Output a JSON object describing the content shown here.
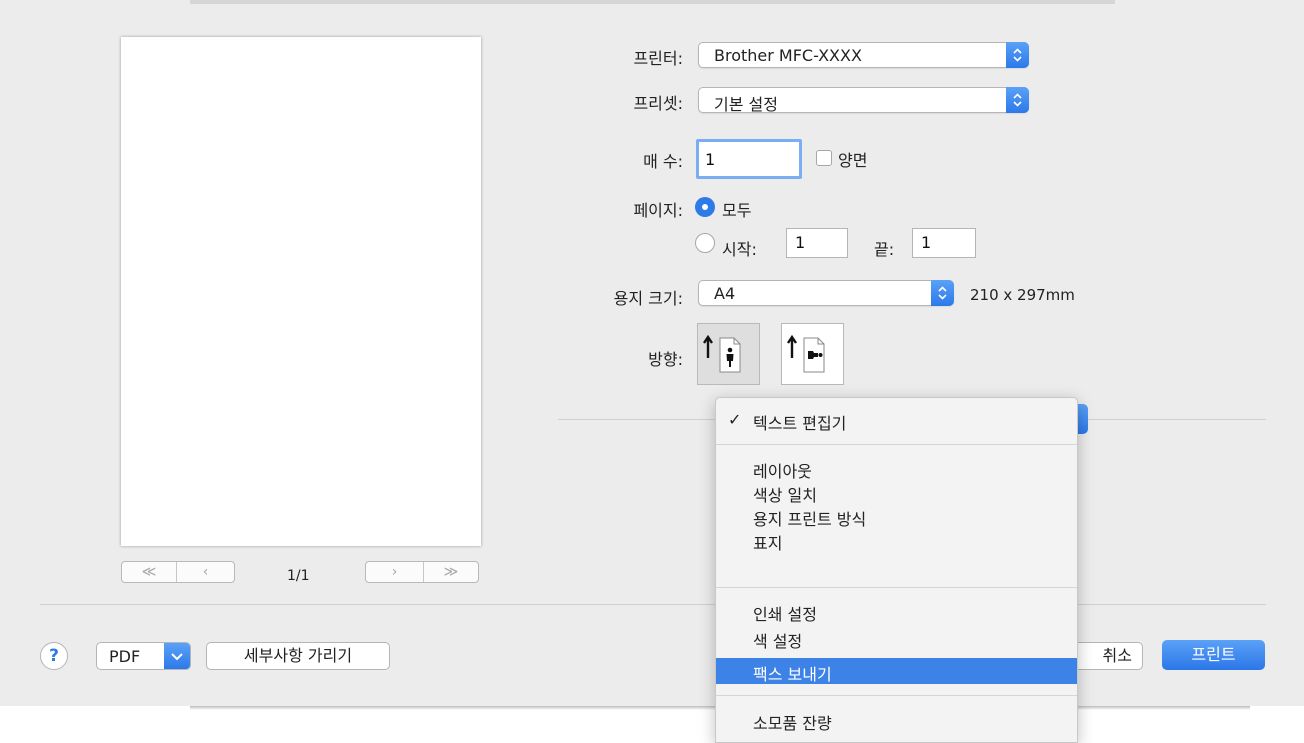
{
  "printer": {
    "label": "프린터:",
    "value": "Brother MFC-XXXX"
  },
  "preset": {
    "label": "프리셋:",
    "value": "기본 설정"
  },
  "copies": {
    "label": "매 수:",
    "value": "1",
    "duplex_label": "양면"
  },
  "pages": {
    "label": "페이지:",
    "all_label": "모두",
    "from_label": "시작:",
    "from_value": "1",
    "to_label": "끝:",
    "to_value": "1"
  },
  "paper_size": {
    "label": "용지 크기:",
    "value": "A4",
    "dimensions": "210 x 297mm"
  },
  "orientation": {
    "label": "방향:",
    "selected": "portrait"
  },
  "preview": {
    "page_count": "1/1",
    "first": "≪",
    "prev": "‹",
    "next": "›",
    "last": "≫"
  },
  "footer": {
    "help": "?",
    "pdf": "PDF",
    "hide_details": "세부사항 가리기",
    "cancel": "취소",
    "print": "프린트"
  },
  "menu": {
    "checked_item": "텍스트 편집기",
    "group1": [
      "레이아웃",
      "색상 일치",
      "용지 프린트 방식",
      "표지"
    ],
    "group2": [
      "인쇄 설정",
      "색 설정",
      "팩스 보내기"
    ],
    "group3": [
      "소모품 잔량"
    ],
    "highlighted": "팩스 보내기"
  },
  "colors": {
    "accent": "#2d7be8",
    "highlight": "#3d82e6",
    "background": "#ececec"
  }
}
